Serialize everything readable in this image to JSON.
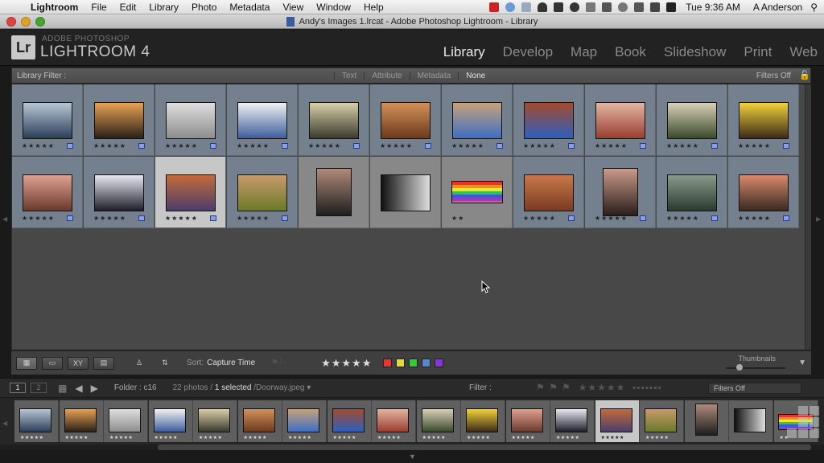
{
  "menubar": {
    "app": "Lightroom",
    "items": [
      "File",
      "Edit",
      "Library",
      "Photo",
      "Metadata",
      "View",
      "Window",
      "Help"
    ],
    "clock": "Tue 9:36 AM",
    "user": "A Anderson"
  },
  "window": {
    "title": "Andy's Images 1.lrcat - Adobe Photoshop Lightroom - Library"
  },
  "app": {
    "logo": "Lr",
    "brand_sub": "ADOBE PHOTOSHOP",
    "brand_main": "LIGHTROOM 4",
    "modules": [
      {
        "label": "Library",
        "active": true
      },
      {
        "label": "Develop",
        "active": false
      },
      {
        "label": "Map",
        "active": false
      },
      {
        "label": "Book",
        "active": false
      },
      {
        "label": "Slideshow",
        "active": false
      },
      {
        "label": "Print",
        "active": false
      },
      {
        "label": "Web",
        "active": false
      }
    ]
  },
  "filter_bar": {
    "label": "Library Filter :",
    "tabs": [
      {
        "label": "Text",
        "on": false
      },
      {
        "label": "Attribute",
        "on": false
      },
      {
        "label": "Metadata",
        "on": false
      },
      {
        "label": "None",
        "on": true
      }
    ],
    "preset": "Filters Off"
  },
  "grid": {
    "photos": [
      {
        "colors": [
          "#2c3f5a",
          "#b7c6d4"
        ],
        "stars": "★★★★★",
        "kind": "land"
      },
      {
        "colors": [
          "#2a2018",
          "#e8a252"
        ],
        "stars": "★★★★★",
        "kind": "land"
      },
      {
        "colors": [
          "#8d8d8d",
          "#dedede"
        ],
        "stars": "★★★★★",
        "kind": "land"
      },
      {
        "colors": [
          "#3d5e9b",
          "#f1f1f1"
        ],
        "stars": "★★★★★",
        "kind": "land"
      },
      {
        "colors": [
          "#3a3a2e",
          "#d9cfa8"
        ],
        "stars": "★★★★★",
        "kind": "land"
      },
      {
        "colors": [
          "#6b3a1c",
          "#d4905a"
        ],
        "stars": "★★★★★",
        "kind": "land"
      },
      {
        "colors": [
          "#3d6fc4",
          "#c7a27a"
        ],
        "stars": "★★★★★",
        "kind": "land"
      },
      {
        "colors": [
          "#2d5fbf",
          "#a44a2c"
        ],
        "stars": "★★★★★",
        "kind": "land"
      },
      {
        "colors": [
          "#9a3d2f",
          "#e2b6a3"
        ],
        "stars": "★★★★★",
        "kind": "land"
      },
      {
        "colors": [
          "#3a4a2a",
          "#d8d0b8"
        ],
        "stars": "★★★★★",
        "kind": "land"
      },
      {
        "colors": [
          "#3c2a18",
          "#f2d23a"
        ],
        "stars": "★★★★★",
        "kind": "land"
      },
      {
        "colors": [
          "#6a3a2e",
          "#e0a090"
        ],
        "stars": "★★★★★",
        "kind": "land"
      },
      {
        "colors": [
          "#1e1e2a",
          "#e8e8f0"
        ],
        "stars": "★★★★★",
        "kind": "land"
      },
      {
        "colors": [
          "#4a3e6a",
          "#c46a3a"
        ],
        "stars": "★★★★★",
        "kind": "land",
        "selected": true
      },
      {
        "colors": [
          "#6a7a2a",
          "#c89a6a"
        ],
        "stars": "★★★★★",
        "kind": "land"
      },
      {
        "colors": [
          "#1e1e1e",
          "#b08a7a"
        ],
        "stars": "",
        "kind": "portrait",
        "gray": true
      },
      {
        "colors": [
          "#111111",
          "#dddddd"
        ],
        "stars": "",
        "kind": "grad",
        "gray": true
      },
      {
        "colors": [],
        "stars": "★★",
        "kind": "flag",
        "gray": true
      },
      {
        "colors": [
          "#7a3a22",
          "#c77a4a"
        ],
        "stars": "★★★★★",
        "kind": "land"
      },
      {
        "colors": [
          "#2a1e1a",
          "#c99a8a"
        ],
        "stars": "★★★★★",
        "kind": "portrait"
      },
      {
        "colors": [
          "#2a3a2e",
          "#8a9a8a"
        ],
        "stars": "★★★★★",
        "kind": "land"
      },
      {
        "colors": [
          "#3a2a22",
          "#d88a6a"
        ],
        "stars": "★★★★★",
        "kind": "land"
      }
    ]
  },
  "toolbar": {
    "sort_label": "Sort:",
    "sort_value": "Capture Time",
    "rating": "★★★★★",
    "color_labels": [
      "#e33",
      "#dd3",
      "#3c3",
      "#58c",
      "#83d"
    ],
    "thumbs_label": "Thumbnails"
  },
  "filmstrip": {
    "source": "Folder : c16",
    "count_pre": "22 photos /",
    "selected": "1 selected",
    "file": "/Doorway.jpeg",
    "filter_label": "Filter :",
    "filter_value": "Filters Off",
    "monitor1": "1",
    "monitor2": "2"
  }
}
